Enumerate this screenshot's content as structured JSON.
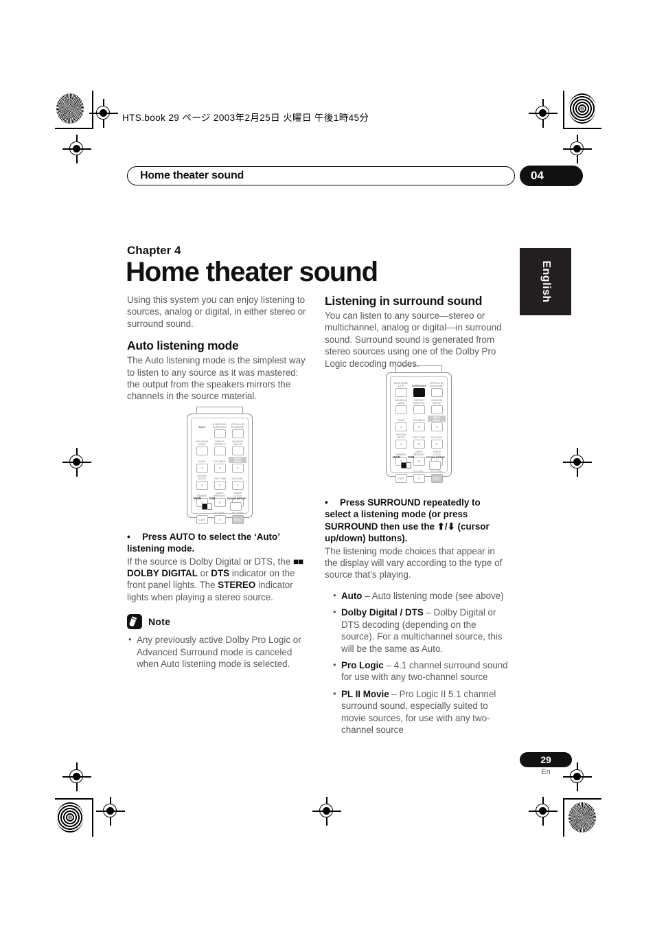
{
  "header": {
    "book_line": "HTS.book 29 ページ 2003年2月25日  火曜日  午後1時45分",
    "running_head": "Home theater sound",
    "chapter_number": "04",
    "language_tab": "English"
  },
  "title": {
    "chapter_label": "Chapter 4",
    "chapter_title": "Home theater sound"
  },
  "left_column": {
    "intro": "Using this system you can enjoy listening to sources, analog or digital, in either stereo or surround sound.",
    "section_heading": "Auto listening mode",
    "section_body": "The Auto listening mode is the simplest way to listen to any source as it was mastered: the output from the speakers mirrors the channels in the source material.",
    "instruction": "Press AUTO to select the ‘Auto’ listening mode.",
    "instruction_body_1": "If the source is Dolby Digital or DTS, the ",
    "instruction_bold_1": "DOLBY DIGITAL",
    "instruction_body_2": " or ",
    "instruction_bold_2": "DTS",
    "instruction_body_3": " indicator on the front panel lights. The ",
    "instruction_bold_3": "STEREO",
    "instruction_body_4": " indicator lights when playing a stereo source.",
    "note_title": "Note",
    "note_icon": "pencil-icon",
    "note_items": [
      "Any previously active Dolby Pro Logic or Advanced Surround mode is canceled when Auto listening mode is selected."
    ]
  },
  "right_column": {
    "section_heading": "Listening in surround sound",
    "section_body": "You can listen to any source—stereo or multichannel, analog or digital—in surround sound. Surround sound is generated from stereo sources using one of the Dolby Pro Logic decoding modes.",
    "instruction": "Press SURROUND repeatedly to select a listening mode (or press SURROUND then use the ⬆/⬇ (cursor up/down) buttons).",
    "instruction_body": "The listening mode choices that appear in the display will vary according to the type of source that’s playing.",
    "modes": [
      {
        "name": "Auto",
        "desc": " – Auto listening mode (see above)"
      },
      {
        "name": "Dolby Digital / DTS",
        "desc": " – Dolby Digital or DTS decoding (depending on the source). For a multichannel source, this will be the same as Auto."
      },
      {
        "name": "Pro Logic",
        "desc": " – 4.1 channel surround sound for use with any two-channel source"
      },
      {
        "name": "PL II Movie",
        "desc": " – Pro Logic II 5.1 channel surround sound, especially suited to movie sources, for use with any two-channel source"
      }
    ]
  },
  "remote": {
    "rows": [
      {
        "labels": [
          "BASS MODE\nAUTO",
          "SURROUND\nSURROUND",
          "VIRTUAL 3D\nADVANCED"
        ],
        "keys": [
          "",
          "",
          ""
        ]
      },
      {
        "labels": [
          "PROGRAM\nAUDIO",
          "REPEAT\nSUBTITLE",
          "RANDOM\nANGLE"
        ],
        "keys": [
          "",
          "",
          ""
        ]
      },
      {
        "labels": [
          "ZOOM",
          "TOP MENU",
          "MENU\nMENU"
        ],
        "keys": [
          "1",
          "2",
          "3"
        ]
      },
      {
        "labels": [
          "SYSTEM\nSETUP",
          "TEST TONE",
          "CH LEVEL"
        ],
        "keys": [
          "4",
          "5",
          "6"
        ]
      },
      {
        "labels": [
          "DIMMER",
          "QUIET/\nMIDNIGHT",
          "TIMER/\nCLOCK"
        ],
        "keys": [
          "7",
          "8",
          "9"
        ]
      },
      {
        "labels": [
          "",
          "FOLDER–",
          "FOLDER+"
        ],
        "keys": [
          "CLR",
          "0",
          "DISC"
        ]
      },
      {
        "labels": [
          "MAIN",
          "SUB",
          "ROOM SETUP"
        ],
        "keys": [
          "",
          "",
          ""
        ]
      }
    ],
    "highlight_left": "AUTO",
    "highlight_right": "SURROUND"
  },
  "footer": {
    "page_number": "29",
    "page_suffix": "En"
  }
}
